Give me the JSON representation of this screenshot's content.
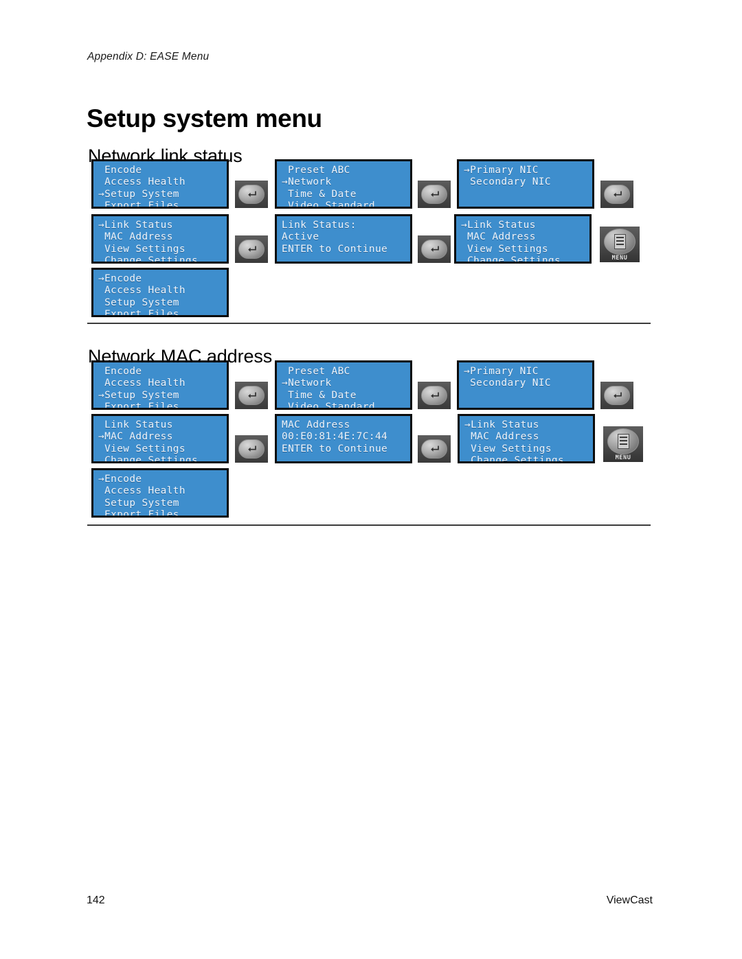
{
  "document": {
    "running_head": "Appendix D: EASE Menu",
    "title": "Setup system menu",
    "footer_page_number": "142",
    "footer_brand": "ViewCast"
  },
  "colors": {
    "lcd_background": "#3E8ECD",
    "lcd_text": "#EEF4FB",
    "lcd_border": "#0B0B0B",
    "rule": "#3C3C3C",
    "button_body": "#4A4A4A"
  },
  "sections": [
    {
      "id": "network-link-status",
      "heading": "Network link status",
      "screens": [
        {
          "name": "main-menu",
          "lines": [
            " Encode",
            " Access Health",
            "→Setup System",
            " Export Files"
          ]
        },
        {
          "name": "setup-system-menu",
          "lines": [
            " Preset ABC",
            "→Network",
            " Time & Date",
            " Video Standard"
          ]
        },
        {
          "name": "network-nic-menu",
          "lines": [
            "→Primary NIC",
            " Secondary NIC",
            "",
            ""
          ]
        },
        {
          "name": "nic-options-menu",
          "lines": [
            "→Link Status",
            " MAC Address",
            " View Settings",
            " Change Settings"
          ]
        },
        {
          "name": "link-status-result",
          "lines": [
            "Link Status:",
            "Active",
            "",
            "ENTER to Continue"
          ]
        },
        {
          "name": "nic-options-menu-return",
          "lines": [
            "→Link Status",
            " MAC Address",
            " View Settings",
            " Change Settings"
          ]
        },
        {
          "name": "main-menu-return",
          "lines": [
            "→Encode",
            " Access Health",
            " Setup System",
            " Export Files"
          ]
        }
      ],
      "buttons": [
        {
          "name": "enter-button",
          "type": "enter",
          "label": ""
        },
        {
          "name": "enter-button",
          "type": "enter",
          "label": ""
        },
        {
          "name": "enter-button",
          "type": "enter",
          "label": ""
        },
        {
          "name": "enter-button",
          "type": "enter",
          "label": ""
        },
        {
          "name": "enter-button",
          "type": "enter",
          "label": ""
        },
        {
          "name": "menu-button",
          "type": "menu",
          "label": "MENU"
        }
      ]
    },
    {
      "id": "network-mac-address",
      "heading": "Network MAC address",
      "screens": [
        {
          "name": "main-menu",
          "lines": [
            " Encode",
            " Access Health",
            "→Setup System",
            " Export Files"
          ]
        },
        {
          "name": "setup-system-menu",
          "lines": [
            " Preset ABC",
            "→Network",
            " Time & Date",
            " Video Standard"
          ]
        },
        {
          "name": "network-nic-menu",
          "lines": [
            "→Primary NIC",
            " Secondary NIC",
            "",
            ""
          ]
        },
        {
          "name": "nic-options-menu",
          "lines": [
            " Link Status",
            "→MAC Address",
            " View Settings",
            " Change Settings"
          ]
        },
        {
          "name": "mac-address-result",
          "lines": [
            "MAC Address",
            "00:E0:81:4E:7C:44",
            "",
            "ENTER to Continue"
          ]
        },
        {
          "name": "nic-options-menu-return",
          "lines": [
            "→Link Status",
            " MAC Address",
            " View Settings",
            " Change Settings"
          ]
        },
        {
          "name": "main-menu-return",
          "lines": [
            "→Encode",
            " Access Health",
            " Setup System",
            " Export Files"
          ]
        }
      ],
      "buttons": [
        {
          "name": "enter-button",
          "type": "enter",
          "label": ""
        },
        {
          "name": "enter-button",
          "type": "enter",
          "label": ""
        },
        {
          "name": "enter-button",
          "type": "enter",
          "label": ""
        },
        {
          "name": "enter-button",
          "type": "enter",
          "label": ""
        },
        {
          "name": "enter-button",
          "type": "enter",
          "label": ""
        },
        {
          "name": "menu-button",
          "type": "menu",
          "label": "MENU"
        }
      ]
    }
  ]
}
